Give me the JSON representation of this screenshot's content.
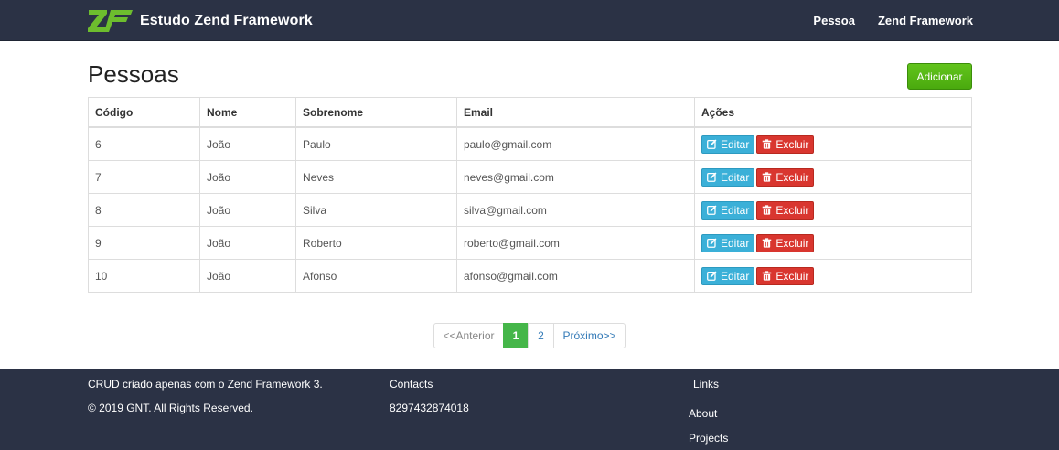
{
  "nav": {
    "brand": "Estudo Zend Framework",
    "links": [
      "Pessoa",
      "Zend Framework"
    ]
  },
  "page": {
    "title": "Pessoas",
    "add_label": "Adicionar"
  },
  "table": {
    "headers": [
      "Código",
      "Nome",
      "Sobrenome",
      "Email",
      "Ações"
    ],
    "rows": [
      {
        "id": "6",
        "nome": "João",
        "sobrenome": "Paulo",
        "email": "paulo@gmail.com"
      },
      {
        "id": "7",
        "nome": "João",
        "sobrenome": "Neves",
        "email": "neves@gmail.com"
      },
      {
        "id": "8",
        "nome": "João",
        "sobrenome": "Silva",
        "email": "silva@gmail.com"
      },
      {
        "id": "9",
        "nome": "João",
        "sobrenome": "Roberto",
        "email": "roberto@gmail.com"
      },
      {
        "id": "10",
        "nome": "João",
        "sobrenome": "Afonso",
        "email": "afonso@gmail.com"
      }
    ],
    "edit_label": "Editar",
    "delete_label": "Excluir"
  },
  "pagination": {
    "prev": "<<Anterior",
    "pages": [
      "1",
      "2"
    ],
    "active_page": "1",
    "next": "Próximo>>"
  },
  "footer": {
    "about_text": "CRUD criado apenas com o Zend Framework 3.",
    "copyright": "©  2019 GNT. All Rights Reserved.",
    "contacts_title": "Contacts",
    "phone": "8297432874018",
    "links_title": "Links",
    "links": [
      "About",
      "Projects"
    ]
  },
  "colors": {
    "navbar": "#2b3245",
    "add_button": "#4aaa0e",
    "edit_button": "#3bb0d8",
    "delete_button": "#d9362f",
    "active_page": "#45b649"
  },
  "icons": {
    "logo": "zend-framework-logo",
    "edit": "edit-icon",
    "delete": "trash-icon"
  }
}
